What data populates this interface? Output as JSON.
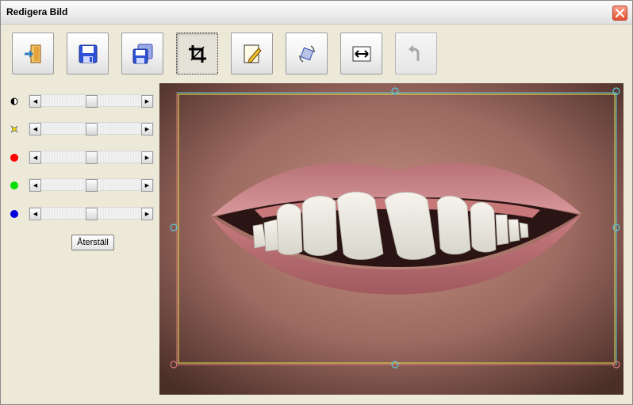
{
  "window": {
    "title": "Redigera Bild"
  },
  "toolbar": {
    "buttons": [
      {
        "name": "exit-button",
        "icon": "exit-door-icon",
        "state": "normal"
      },
      {
        "name": "save-button",
        "icon": "floppy-disk-icon",
        "state": "normal"
      },
      {
        "name": "save-as-button",
        "icon": "floppy-disk-copy-icon",
        "state": "normal"
      },
      {
        "name": "crop-button",
        "icon": "crop-icon",
        "state": "active"
      },
      {
        "name": "edit-button",
        "icon": "pencil-note-icon",
        "state": "normal"
      },
      {
        "name": "rotate-button",
        "icon": "rotate-icon",
        "state": "normal"
      },
      {
        "name": "resize-button",
        "icon": "resize-horizontal-icon",
        "state": "normal"
      },
      {
        "name": "undo-button",
        "icon": "undo-arrow-icon",
        "state": "disabled"
      }
    ]
  },
  "adjustments": {
    "sliders": [
      {
        "name": "contrast",
        "icon": "contrast-icon",
        "value": 0.5,
        "color": "#000000"
      },
      {
        "name": "brightness",
        "icon": "brightness-sun-icon",
        "value": 0.5,
        "color": "#e8d800"
      },
      {
        "name": "red",
        "icon": "red-dot-icon",
        "value": 0.5,
        "color": "#ff0000"
      },
      {
        "name": "green",
        "icon": "green-dot-icon",
        "value": 0.5,
        "color": "#00dd00"
      },
      {
        "name": "blue",
        "icon": "blue-dot-icon",
        "value": 0.5,
        "color": "#0000dd"
      }
    ],
    "reset_label": "Återställ"
  },
  "image": {
    "subject": "smiling-mouth-teeth-photo",
    "crop_colors": {
      "frame": "#5fc8d8",
      "inner": "#e6e64a",
      "handle": "#5fc8d8",
      "corner": "#d87a7a"
    }
  },
  "colors": {
    "window_bg": "#ece9d8",
    "accent": "#3a5ce0"
  }
}
